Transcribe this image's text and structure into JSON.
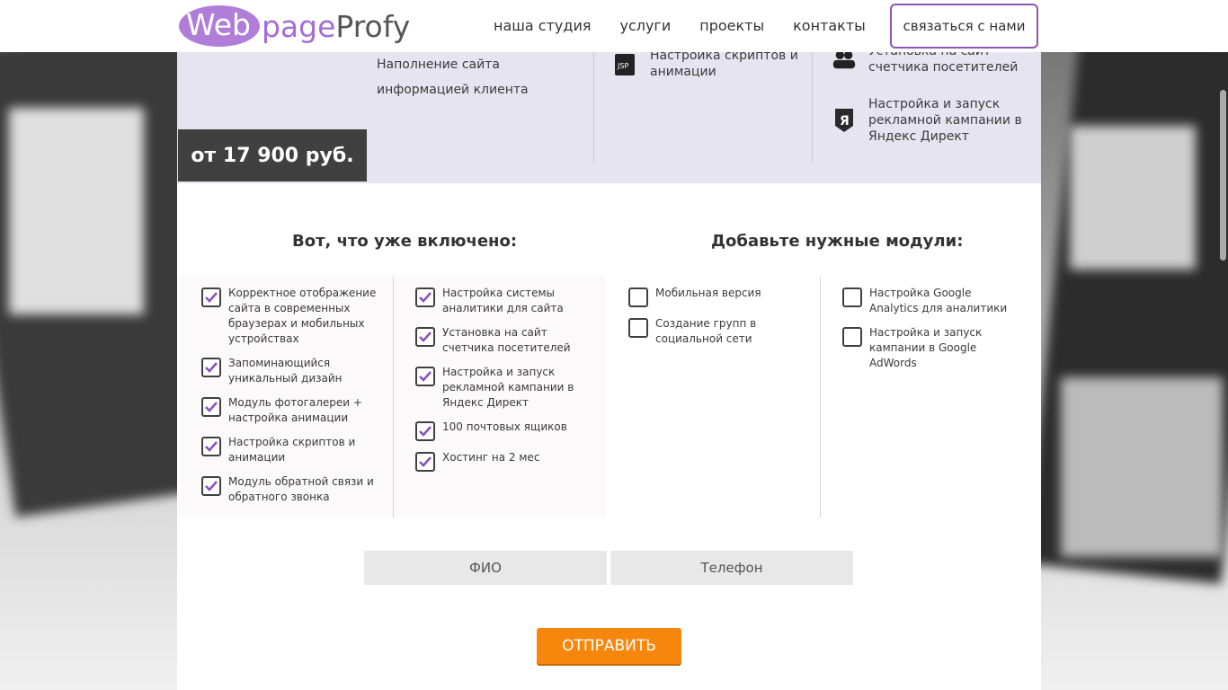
{
  "logo": {
    "part1": "Web",
    "part2": "page",
    "part3": "Profy"
  },
  "nav": [
    "наша студия",
    "услуги",
    "проекты",
    "контакты"
  ],
  "contact_button": "связаться с нами",
  "package": {
    "price": "от 17 900 руб.",
    "band_col1": "Наполнение сайта информацией клиента",
    "band_col2": "Настройка скриптов и анимации",
    "band_col3_a": "Установка на сайт счетчика посетителей",
    "band_col3_b": "Настройка и запуск рекламной кампании в Яндекс Директ",
    "band_col2_icon_text": "JSP"
  },
  "included_title": "Вот, что уже включено:",
  "modules_title": "Добавьте нужные модули:",
  "included_col1": [
    "Корректное отображение сайта в современных браузерах и мобильных устройствах",
    "Запоминающийся уникальный дизайн",
    "Модуль фотогалереи + настройка анимации",
    "Настройка скриптов и анимации",
    "Модуль обратной связи и обратного звонка"
  ],
  "included_col2": [
    "Настройка системы аналитики для сайта",
    "Установка на сайт счетчика посетителей",
    "Настройка и запуск рекламной кампании в Яндекс Директ",
    "100 почтовых ящиков",
    "Хостинг на 2 мес"
  ],
  "modules_col1": [
    "Мобильная версия",
    "Создание групп в социальной сети"
  ],
  "modules_col2": [
    "Настройка Google Analytics для аналитики",
    "Настройка и запуск кампании в Google AdWords"
  ],
  "form": {
    "name_placeholder": "ФИО",
    "phone_placeholder": "Телефон",
    "submit": "ОТПРАВИТЬ"
  },
  "colors": {
    "accent_purple": "#8d55b5",
    "checkmark": "#8a4fc0",
    "submit_orange": "#f7860d",
    "band_bg": "#e7e4f1"
  }
}
